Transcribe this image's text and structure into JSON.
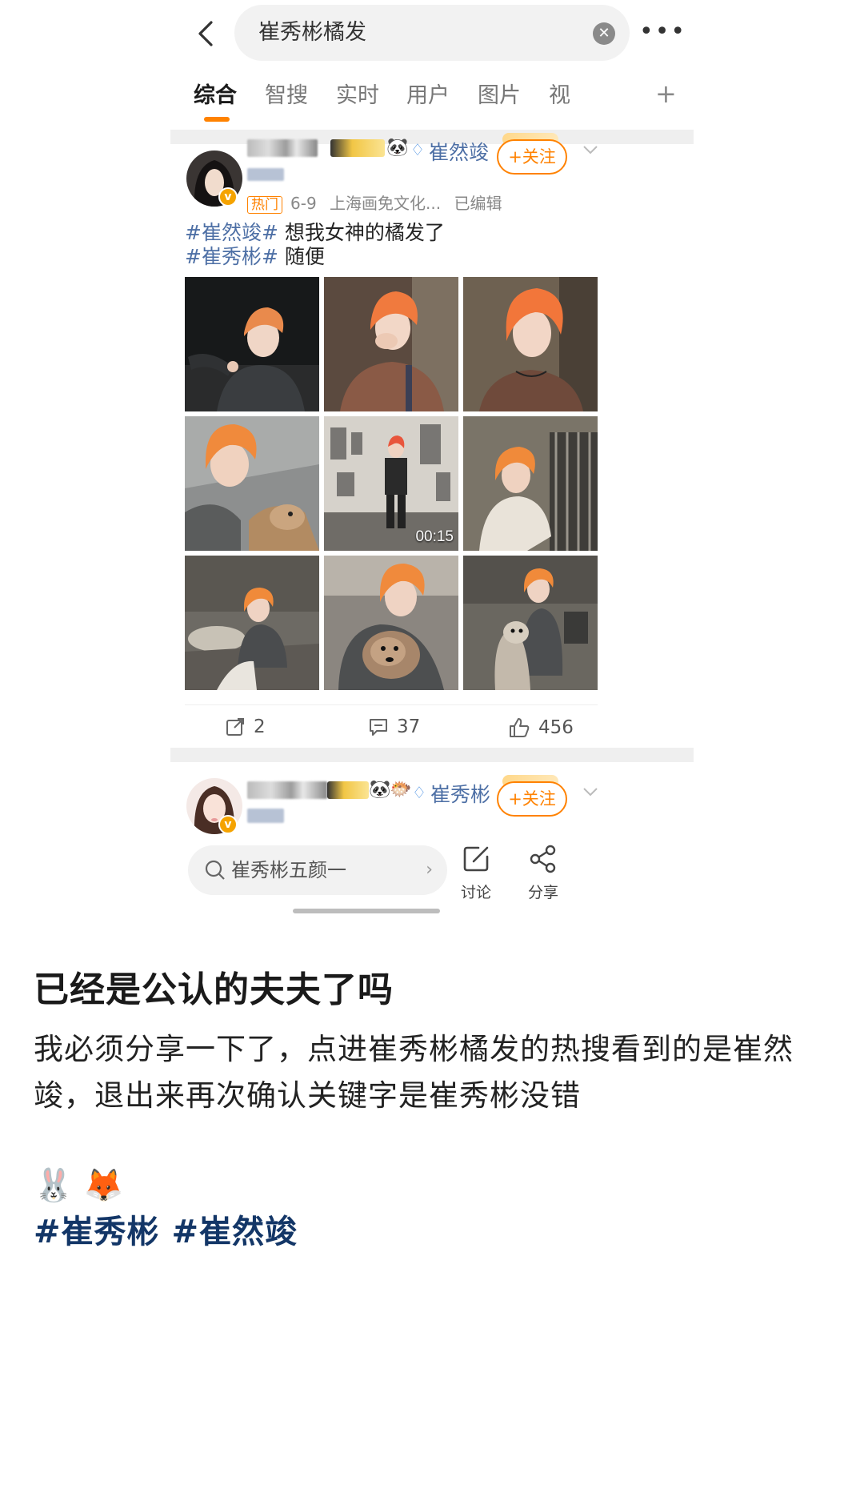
{
  "search": {
    "query": "崔秀彬橘发"
  },
  "tabs": [
    {
      "label": "综合"
    },
    {
      "label": "智搜"
    },
    {
      "label": "实时"
    },
    {
      "label": "用户"
    },
    {
      "label": "图片"
    },
    {
      "label": "视"
    }
  ],
  "post1": {
    "channel": "崔然竣",
    "follow": "+关注",
    "hot": "热门",
    "date": "6-9",
    "source": "上海画免文化...",
    "edited": "已编辑",
    "line1_tag": "#崔然竣#",
    "line1_text": " 想我女神的橘发了",
    "line2_tag": "#崔秀彬#",
    "line2_text": " 随便",
    "video_duration": "00:15",
    "reposts": "2",
    "comments": "37",
    "likes": "456"
  },
  "post2": {
    "channel": "崔秀彬",
    "follow": "+关注"
  },
  "bottom_bar": {
    "hint": "崔秀彬五颜一",
    "discuss": "讨论",
    "share": "分享"
  },
  "note": {
    "title": "已经是公认的夫夫了吗",
    "body": "我必须分享一下了，点进崔秀彬橘发的热搜看到的是崔然竣，退出来再次确认关键字是崔秀彬没错",
    "emojis": "🐰 🦊",
    "tags": "#崔秀彬 #崔然竣"
  }
}
